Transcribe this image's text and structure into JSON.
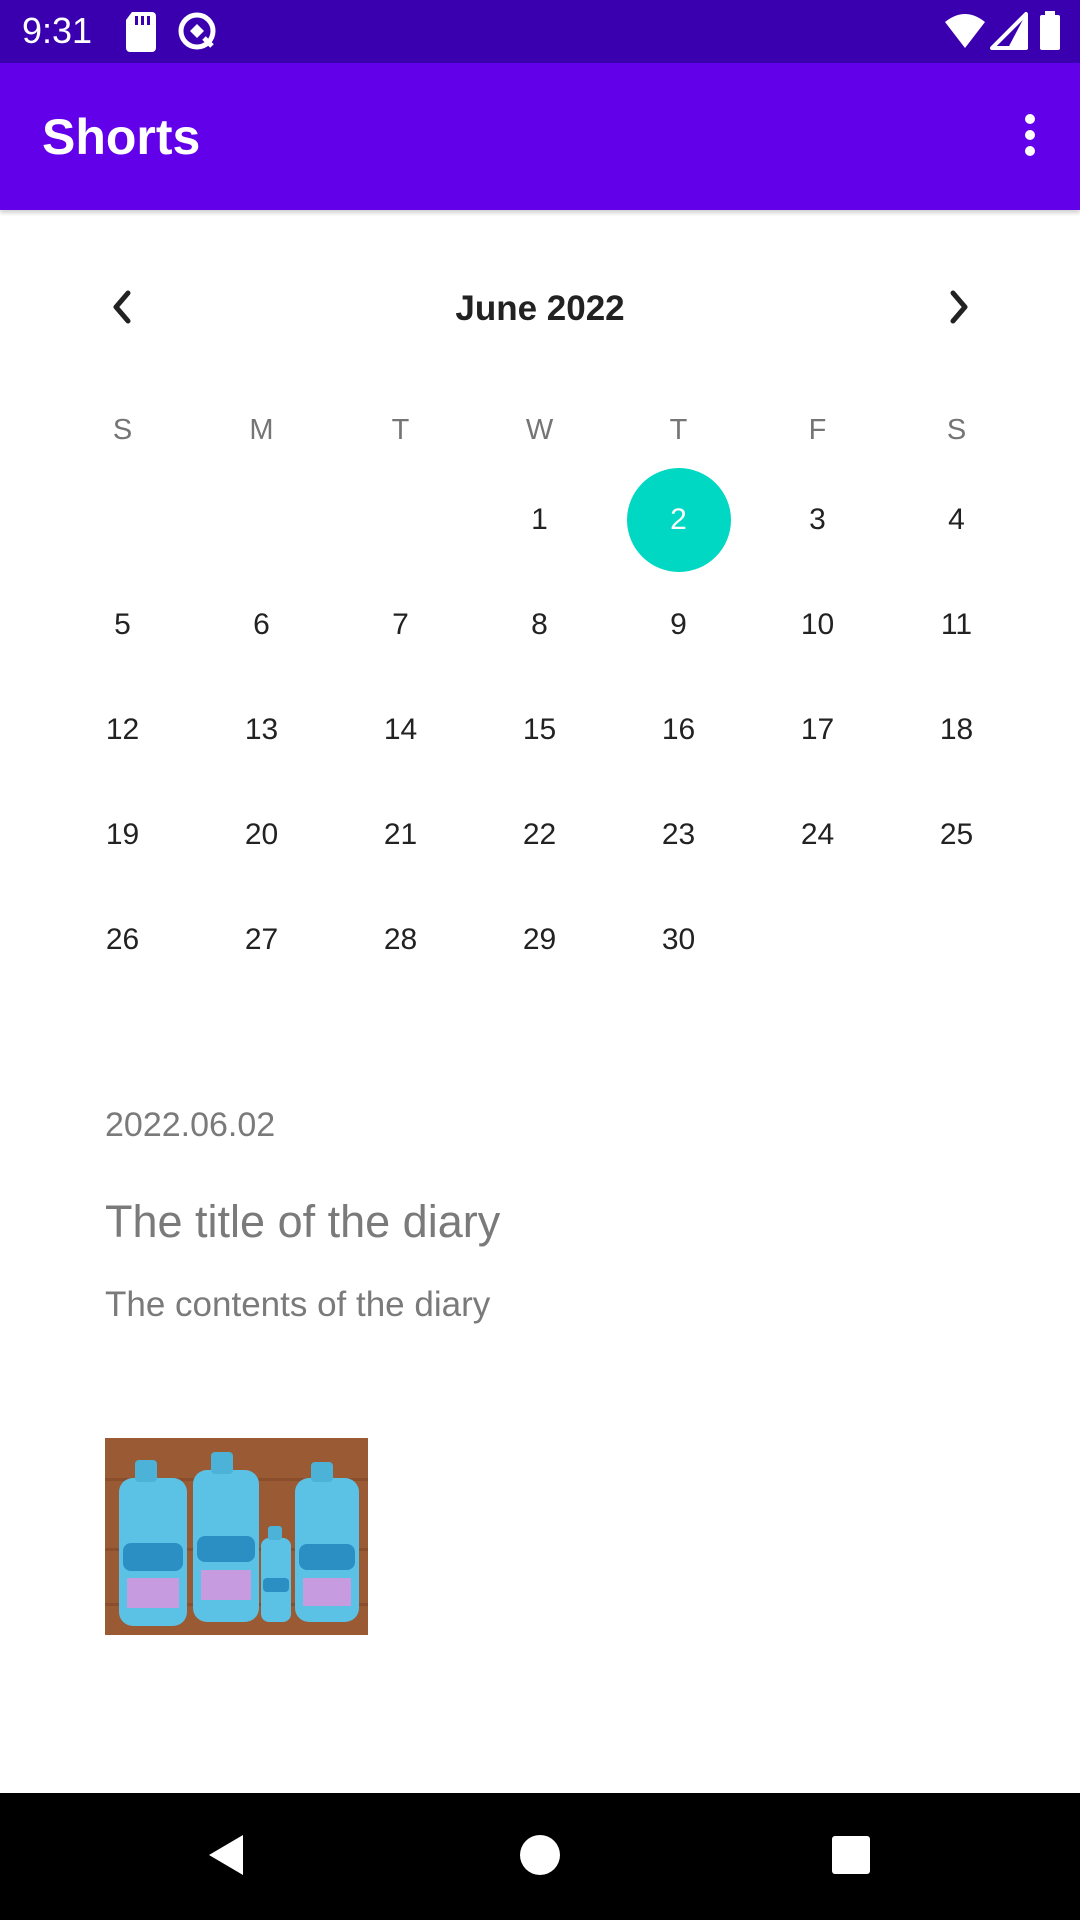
{
  "status_bar": {
    "time": "9:31",
    "icons": [
      "sd-card-icon",
      "sync-icon",
      "wifi-icon",
      "signal-icon",
      "battery-icon"
    ]
  },
  "app_bar": {
    "title": "Shorts",
    "menu_icon": "more-vert-icon"
  },
  "calendar": {
    "month_title": "June 2022",
    "prev_icon": "chevron-left-icon",
    "next_icon": "chevron-right-icon",
    "weekdays": [
      "S",
      "M",
      "T",
      "W",
      "T",
      "F",
      "S"
    ],
    "weeks": [
      [
        "",
        "",
        "",
        "1",
        "2",
        "3",
        "4"
      ],
      [
        "5",
        "6",
        "7",
        "8",
        "9",
        "10",
        "11"
      ],
      [
        "12",
        "13",
        "14",
        "15",
        "16",
        "17",
        "18"
      ],
      [
        "19",
        "20",
        "21",
        "22",
        "23",
        "24",
        "25"
      ],
      [
        "26",
        "27",
        "28",
        "29",
        "30",
        "",
        ""
      ]
    ],
    "selected_day": "2",
    "selected_color": "#00d8c3"
  },
  "diary": {
    "date": "2022.06.02",
    "title": "The title of the diary",
    "contents": "The contents of the diary",
    "photo_icon": "diary-photo"
  },
  "nav_bar": {
    "icons": [
      "back-icon",
      "home-icon",
      "recents-icon"
    ]
  },
  "colors": {
    "status_bar": "#3a00b0",
    "app_bar": "#6200ea",
    "accent": "#00d8c3"
  }
}
